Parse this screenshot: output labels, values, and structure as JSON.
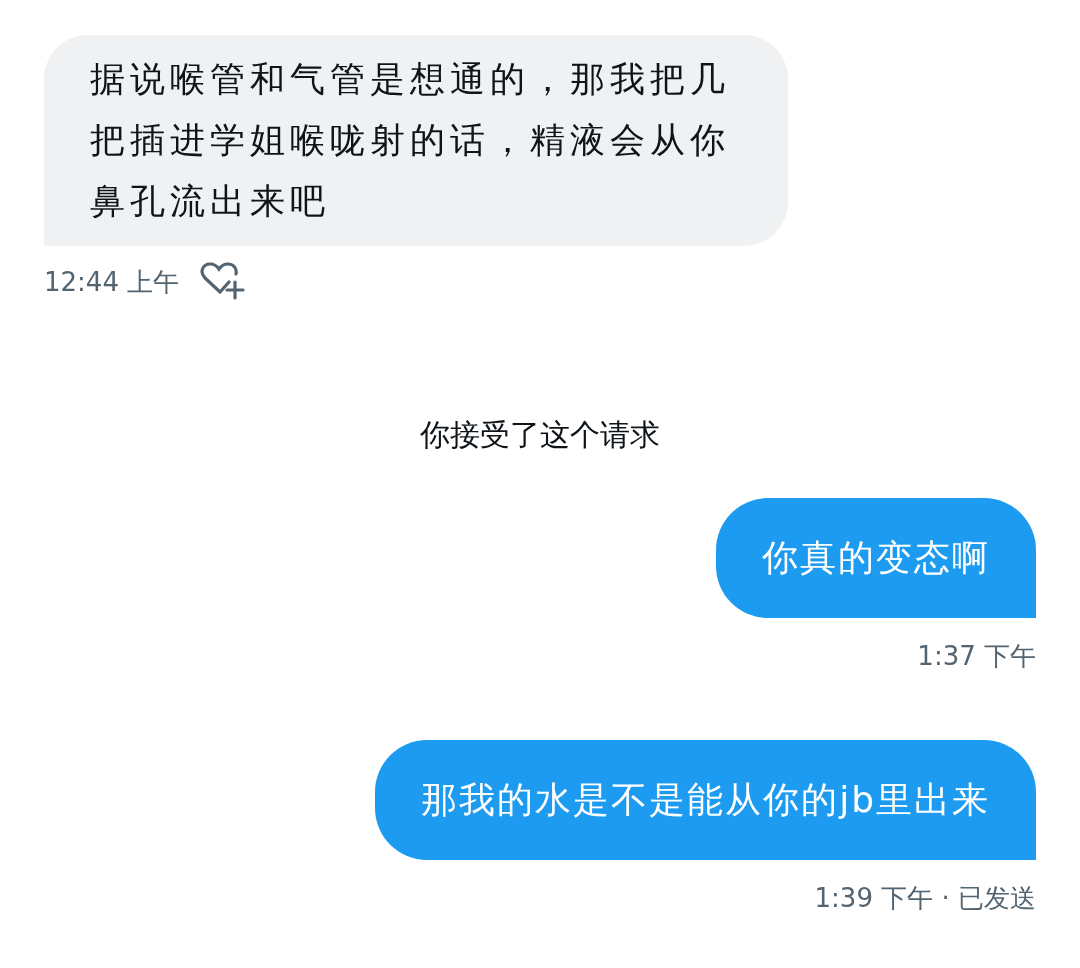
{
  "messages": [
    {
      "kind": "received",
      "text": "据说喉管和气管是想通的，那我把几把插进学姐喉咙射的话，精液会从你鼻孔流出来吧",
      "time": "12:44 上午"
    },
    {
      "kind": "system",
      "text": "你接受了这个请求"
    },
    {
      "kind": "sent",
      "text": "你真的变态啊",
      "time": "1:37 下午"
    },
    {
      "kind": "sent",
      "text": "那我的水是不是能从你的jb里出来",
      "time": "1:39 下午 · 已发送"
    }
  ]
}
